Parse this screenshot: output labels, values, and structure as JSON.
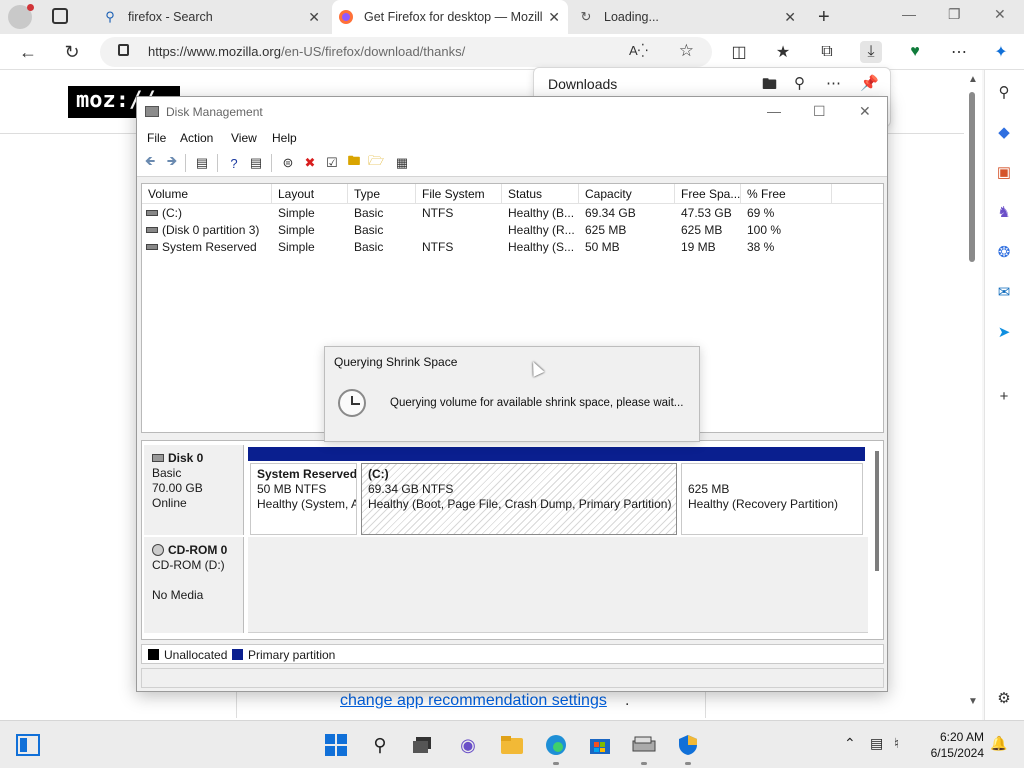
{
  "browser": {
    "tabs": [
      {
        "title": "firefox - Search",
        "icon": "search-icon"
      },
      {
        "title": "Get Firefox for desktop — Mozill",
        "icon": "firefox-icon",
        "active": true
      },
      {
        "title": "Loading...",
        "icon": "loading-icon"
      }
    ],
    "url": {
      "domain": "https://www.mozilla.org",
      "path": "/en-US/firefox/download/thanks/"
    },
    "downloads": {
      "title": "Downloads"
    }
  },
  "page": {
    "logo_text": "moz://",
    "link_text": "change app recommendation settings",
    "link_suffix": "."
  },
  "disk_mgmt": {
    "title": "Disk Management",
    "menu": [
      "File",
      "Action",
      "View",
      "Help"
    ],
    "columns": [
      "Volume",
      "Layout",
      "Type",
      "File System",
      "Status",
      "Capacity",
      "Free Spa...",
      "% Free"
    ],
    "volumes": [
      {
        "volume": "(C:)",
        "layout": "Simple",
        "type": "Basic",
        "fs": "NTFS",
        "status": "Healthy (B...",
        "capacity": "69.34 GB",
        "free": "47.53 GB",
        "pct": "69 %"
      },
      {
        "volume": "(Disk 0 partition 3)",
        "layout": "Simple",
        "type": "Basic",
        "fs": "",
        "status": "Healthy (R...",
        "capacity": "625 MB",
        "free": "625 MB",
        "pct": "100 %"
      },
      {
        "volume": "System Reserved",
        "layout": "Simple",
        "type": "Basic",
        "fs": "NTFS",
        "status": "Healthy (S...",
        "capacity": "50 MB",
        "free": "19 MB",
        "pct": "38 %"
      }
    ],
    "disk0": {
      "name": "Disk 0",
      "type": "Basic",
      "size": "70.00 GB",
      "state": "Online",
      "partitions": [
        {
          "name": "System Reserved",
          "size": "50 MB NTFS",
          "status": "Healthy (System, A"
        },
        {
          "name": "(C:)",
          "size": "69.34 GB NTFS",
          "status": "Healthy (Boot, Page File, Crash Dump, Primary Partition)"
        },
        {
          "name": "",
          "size": "625 MB",
          "status": "Healthy (Recovery Partition)"
        }
      ]
    },
    "cdrom": {
      "name": "CD-ROM 0",
      "drive": "CD-ROM (D:)",
      "media": "No Media"
    },
    "legend": [
      {
        "label": "Unallocated",
        "color": "#000000"
      },
      {
        "label": "Primary partition",
        "color": "#0a1f8f"
      }
    ]
  },
  "dialog": {
    "title": "Querying Shrink Space",
    "message": "Querying volume for available shrink space, please wait..."
  },
  "taskbar": {
    "time": "6:20 AM",
    "date": "6/15/2024"
  }
}
